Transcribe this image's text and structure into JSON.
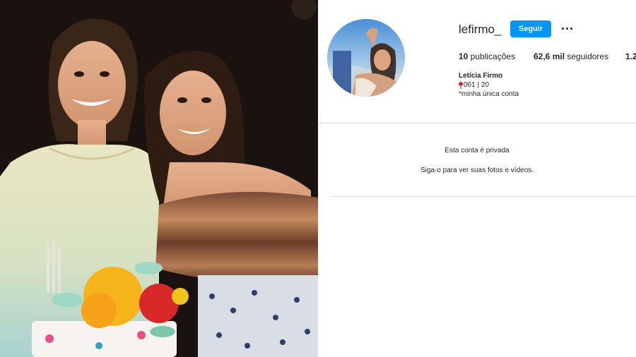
{
  "profile": {
    "username": "lefirmo_",
    "follow_label": "Seguir",
    "more_icon": "more-options-icon",
    "stats": {
      "posts_count": "10",
      "posts_label": "publicações",
      "followers_count": "62,6 mil",
      "followers_label": "seguidores",
      "following_count": "1.2"
    },
    "full_name": "Letícia Firmo",
    "bio_line_1": "061 | 20",
    "bio_pin_icon": "round-pushpin-icon",
    "bio_line_2": "*minha única conta"
  },
  "private_notice": {
    "title": "Esta conta é privada",
    "subtitle": "Siga-o para ver suas fotos e vídeos."
  },
  "colors": {
    "follow_button": "#0095f6",
    "divider": "#dbdbdb",
    "text": "#262626"
  }
}
